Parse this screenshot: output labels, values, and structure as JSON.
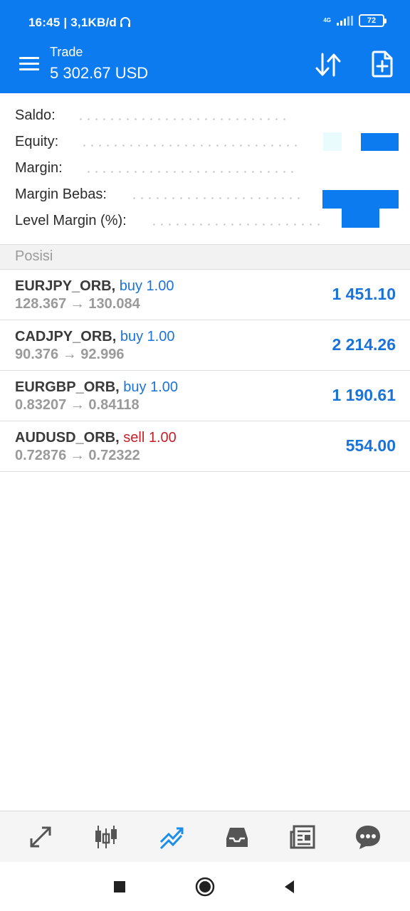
{
  "status_bar": {
    "time_speed": "16:45 | 3,1KB/d",
    "network": "4G",
    "battery": "72"
  },
  "header": {
    "title": "Trade",
    "balance": "5 302.67 USD"
  },
  "summary": {
    "rows": [
      {
        "label": "Saldo:"
      },
      {
        "label": "Equity:"
      },
      {
        "label": "Margin:"
      },
      {
        "label": "Margin Bebas:"
      },
      {
        "label": "Level Margin (%):"
      }
    ]
  },
  "positions_section": {
    "title": "Posisi"
  },
  "positions": [
    {
      "symbol": "EURJPY_ORB,",
      "direction": "buy 1.00",
      "prices": "128.367 → 130.084",
      "profit": "1 451.10"
    },
    {
      "symbol": "CADJPY_ORB,",
      "direction": "buy 1.00",
      "prices": "90.376 → 92.996",
      "profit": "2 214.26"
    },
    {
      "symbol": "EURGBP_ORB,",
      "direction": "buy 1.00",
      "prices": "0.83207 → 0.84118",
      "profit": "1 190.61"
    },
    {
      "symbol": "AUDUSD_ORB,",
      "direction": "sell 1.00",
      "prices": "0.72876 → 0.72322",
      "profit": "554.00"
    }
  ],
  "bottom_nav": {
    "items": [
      {
        "icon": "quotes-icon"
      },
      {
        "icon": "chart-candles-icon"
      },
      {
        "icon": "trade-icon"
      },
      {
        "icon": "history-inbox-icon"
      },
      {
        "icon": "news-icon"
      },
      {
        "icon": "chat-icon"
      }
    ]
  },
  "colors": {
    "brand_blue": "#0d7bf0",
    "buy_blue": "#1a73d9",
    "sell_red": "#c8202a"
  }
}
